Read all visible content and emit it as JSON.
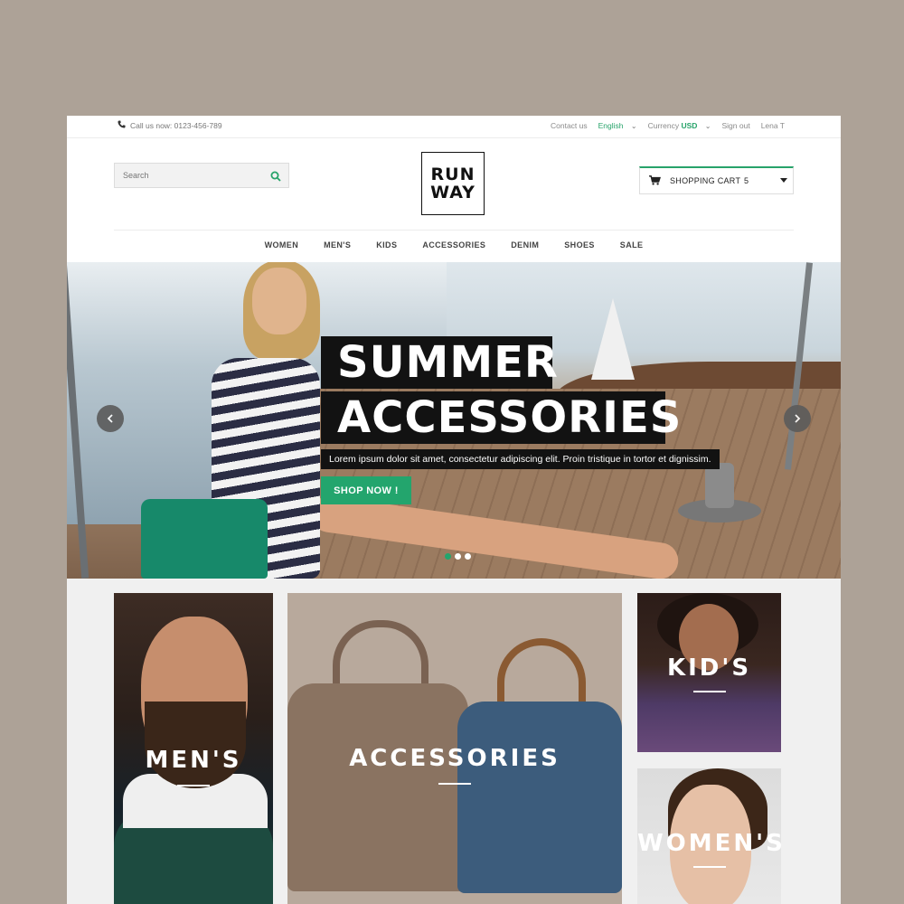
{
  "topbar": {
    "phone_text": "Call us now: 0123-456-789",
    "contact": "Contact us",
    "language": "English",
    "currency_label": "Currency",
    "currency_value": "USD",
    "sign_out": "Sign out",
    "user": "Lena T"
  },
  "header": {
    "search_placeholder": "Search",
    "logo_line1": "RUN",
    "logo_line2": "WAY",
    "cart_label": "SHOPPING CART",
    "cart_count": "5"
  },
  "nav": {
    "items": [
      "WOMEN",
      "MEN'S",
      "KIDS",
      "ACCESSORIES",
      "DENIM",
      "SHOES",
      "SALE"
    ]
  },
  "hero": {
    "title_line1": "SUMMER",
    "title_line2": "ACCESSORIES",
    "description": "Lorem ipsum dolor sit amet, consectetur adipiscing elit. Proin tristique in tortor et dignissim.",
    "cta": "SHOP NOW !",
    "slide_count": 3,
    "active_slide": 1
  },
  "categories": {
    "men": "MEN'S",
    "accessories": "ACCESSORIES",
    "kids": "KID'S",
    "women": "WOMEN'S"
  },
  "colors": {
    "accent": "#23a56d",
    "background": "#ada297"
  },
  "icons": [
    "phone-icon",
    "search-icon",
    "cart-icon",
    "chevron-down-icon",
    "arrow-left-icon",
    "arrow-right-icon"
  ]
}
